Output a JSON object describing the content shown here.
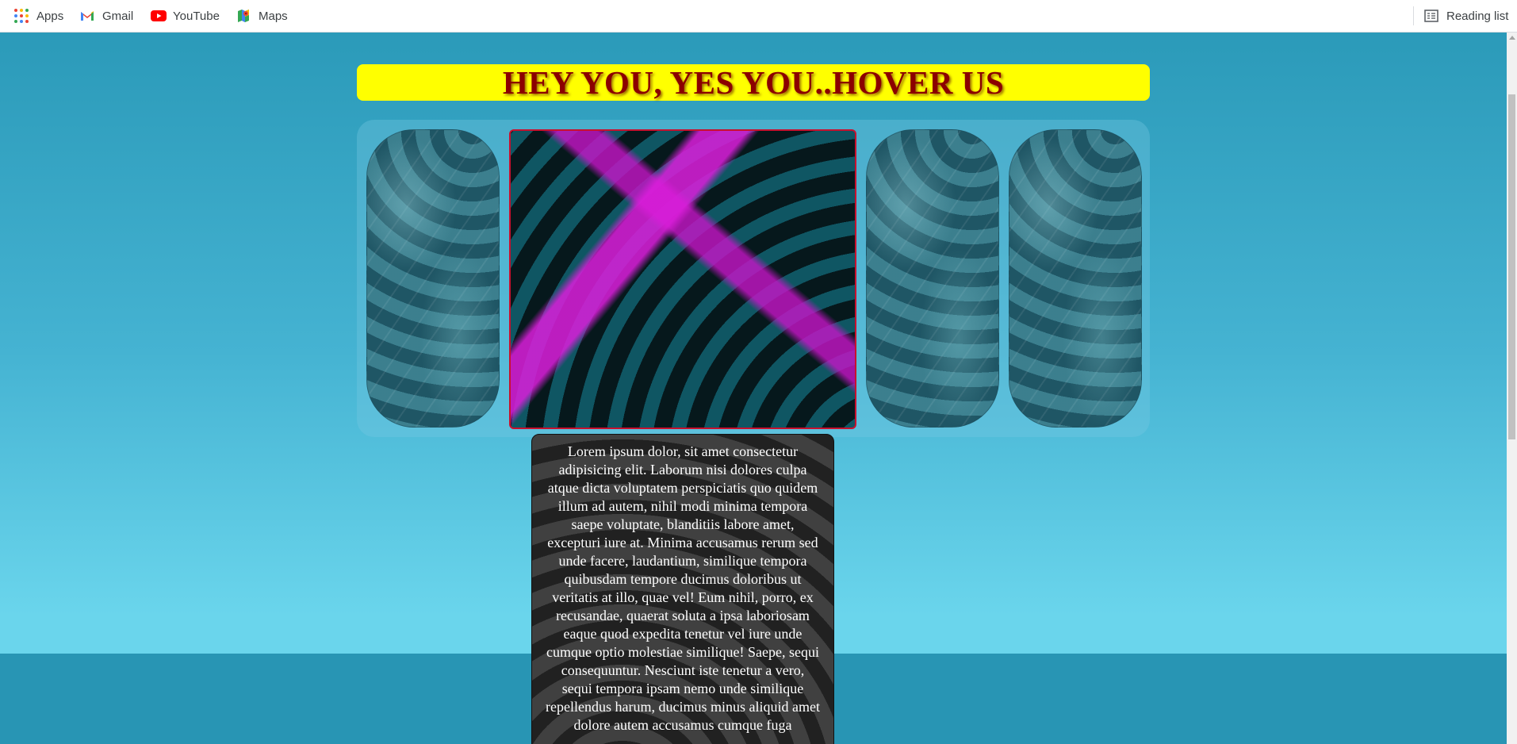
{
  "bookmarks": {
    "apps": "Apps",
    "gmail": "Gmail",
    "youtube": "YouTube",
    "maps": "Maps",
    "reading_list": "Reading list"
  },
  "page": {
    "banner": "HEY YOU, YES YOU..HOVER US",
    "description": "Lorem ipsum dolor, sit amet consectetur adipisicing elit. Laborum nisi dolores culpa atque dicta voluptatem perspiciatis quo quidem illum ad autem, nihil modi minima tempora saepe voluptate, blanditiis labore amet, excepturi iure at. Minima accusamus rerum sed unde facere, laudantium, similique tempora quibusdam tempore ducimus doloribus ut veritatis at illo, quae vel! Eum nihil, porro, ex recusandae, quaerat soluta a ipsa laboriosam eaque quod expedita tenetur vel iure unde cumque optio molestiae similique! Saepe, sequi consequuntur. Nesciunt iste tenetur a vero, sequi tempora ipsam nemo unde similique repellendus harum, ducimus minus aliquid amet dolore autem accusamus cumque fuga"
  },
  "colors": {
    "banner_bg": "#ffff00",
    "banner_text": "#8b0000",
    "page_bg_top": "#2b9ab9",
    "page_bg_bottom": "#6ad5ec",
    "active_card_border": "#c8102e"
  },
  "icons": {
    "apps": "apps-grid-icon",
    "gmail": "gmail-icon",
    "youtube": "youtube-icon",
    "maps": "maps-icon",
    "reading_list": "reading-list-icon"
  }
}
